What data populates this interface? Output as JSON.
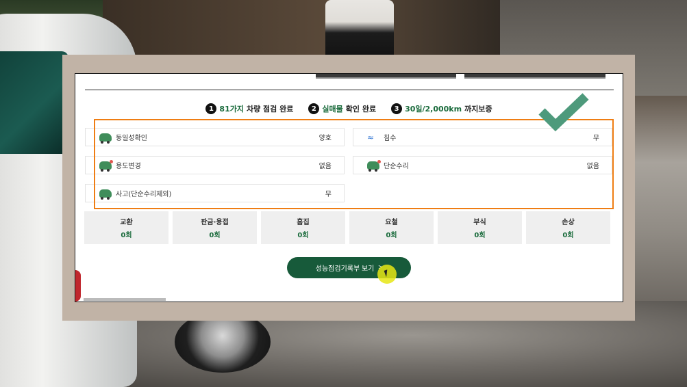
{
  "steps": [
    {
      "num": "1",
      "highlight": "81가지",
      "text": "차량 점검 완료"
    },
    {
      "num": "2",
      "highlight": "실매물",
      "text": "확인 완료"
    },
    {
      "num": "3",
      "highlight": "30일/2,000km",
      "text": "까지보증"
    }
  ],
  "items": [
    {
      "icon": "car-icon",
      "label": "동일성확인",
      "value": "양호"
    },
    {
      "icon": "flood-icon",
      "label": "침수",
      "value": "무"
    },
    {
      "icon": "car-usage-change-icon",
      "label": "용도변경",
      "value": "없음"
    },
    {
      "icon": "car-repair-icon",
      "label": "단순수리",
      "value": "없음"
    },
    {
      "icon": "car-accident-icon",
      "label": "사고(단순수리제외)",
      "value": "무"
    }
  ],
  "counts": [
    {
      "label": "교환",
      "value": "0회"
    },
    {
      "label": "판금·용접",
      "value": "0회"
    },
    {
      "label": "흠집",
      "value": "0회"
    },
    {
      "label": "요철",
      "value": "0회"
    },
    {
      "label": "부식",
      "value": "0회"
    },
    {
      "label": "손상",
      "value": "0회"
    }
  ],
  "button": {
    "label": "성능점검기록부 보기",
    "chevron": ">"
  },
  "colors": {
    "accent": "#1a6b3c",
    "button": "#175a3a",
    "highlight_box": "#ef7d13",
    "check": "#4e9a7c"
  }
}
